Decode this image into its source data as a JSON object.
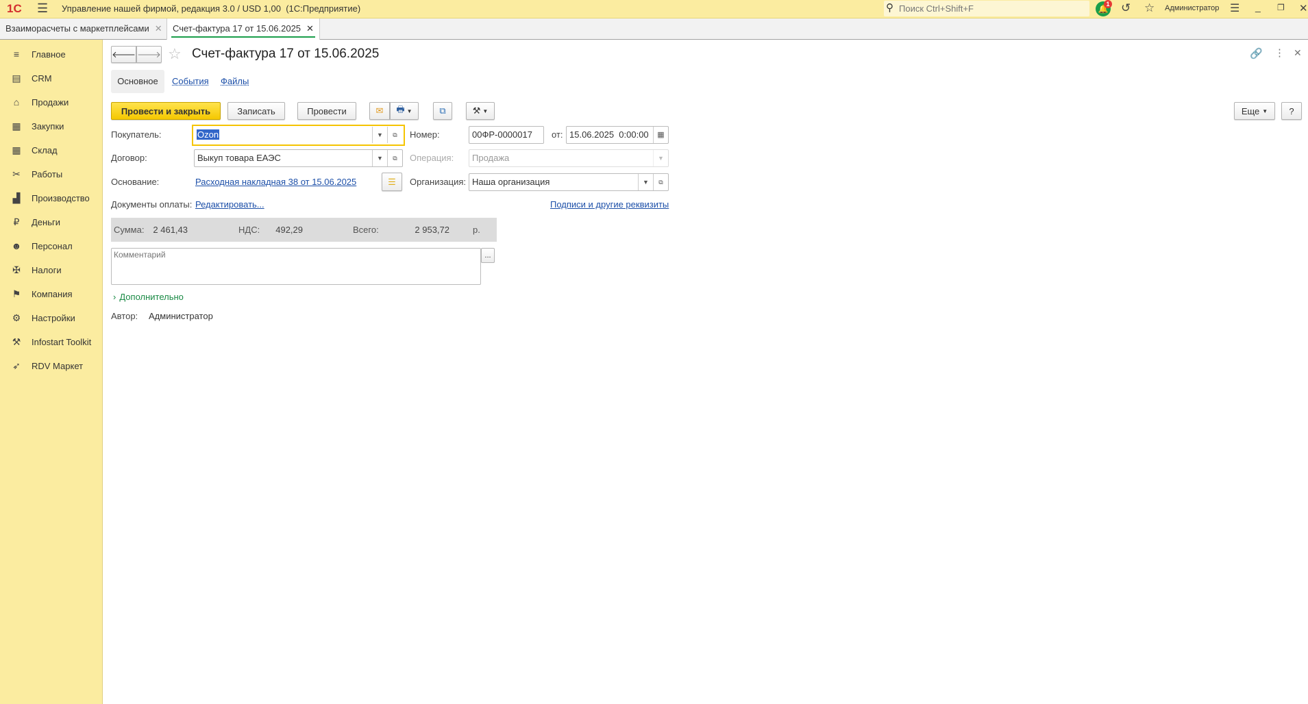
{
  "app": {
    "title": "Управление нашей фирмой, редакция 3.0 / USD 1,00  (1С:Предприятие)",
    "search_placeholder": "Поиск Ctrl+Shift+F",
    "notifications": "1",
    "user": "Администратор"
  },
  "open_tabs": [
    {
      "label": "Взаиморасчеты с маркетплейсами"
    },
    {
      "label": "Счет-фактура 17 от 15.06.2025"
    }
  ],
  "sidebar": {
    "items": [
      {
        "label": "Главное",
        "icon": "≡"
      },
      {
        "label": "CRM",
        "icon": "▤"
      },
      {
        "label": "Продажи",
        "icon": "⌂"
      },
      {
        "label": "Закупки",
        "icon": "▦"
      },
      {
        "label": "Склад",
        "icon": "▦"
      },
      {
        "label": "Работы",
        "icon": "✂"
      },
      {
        "label": "Производство",
        "icon": "▟"
      },
      {
        "label": "Деньги",
        "icon": "₽"
      },
      {
        "label": "Персонал",
        "icon": "☻"
      },
      {
        "label": "Налоги",
        "icon": "✠"
      },
      {
        "label": "Компания",
        "icon": "⚑"
      },
      {
        "label": "Настройки",
        "icon": "⚙"
      },
      {
        "label": "Infostart Toolkit",
        "icon": "⚒"
      },
      {
        "label": "RDV Маркет",
        "icon": "➶"
      }
    ]
  },
  "form": {
    "title": "Счет-фактура 17 от 15.06.2025",
    "tabs": [
      "Основное",
      "События",
      "Файлы"
    ],
    "buttons": {
      "post_close": "Провести и закрыть",
      "save": "Записать",
      "post": "Провести",
      "more": "Еще",
      "help": "?"
    },
    "buyer": {
      "label": "Покупатель:",
      "value": "Ozon"
    },
    "number": {
      "label": "Номер:",
      "value": "00ФР-0000017"
    },
    "date": {
      "label": "от:",
      "value": "15.06.2025  0:00:00"
    },
    "contract": {
      "label": "Договор:",
      "value": "Выкуп товара ЕАЭС"
    },
    "operation": {
      "label": "Операция:",
      "value": "Продажа"
    },
    "basis": {
      "label": "Основание:",
      "value": "Расходная накладная 38 от 15.06.2025"
    },
    "organization": {
      "label": "Организация:",
      "value": "Наша организация"
    },
    "payment_docs": {
      "label": "Документы оплаты:",
      "link": "Редактировать..."
    },
    "signatures_link": "Подписи и другие реквизиты",
    "totals": {
      "sum_label": "Сумма:",
      "sum": "2 461,43",
      "vat_label": "НДС:",
      "vat": "492,29",
      "total_label": "Всего:",
      "total": "2 953,72",
      "currency": "р."
    },
    "comment_placeholder": "Комментарий",
    "comment_button": "...",
    "additional": "Дополнительно",
    "author": {
      "label": "Автор:",
      "value": "Администратор"
    }
  }
}
